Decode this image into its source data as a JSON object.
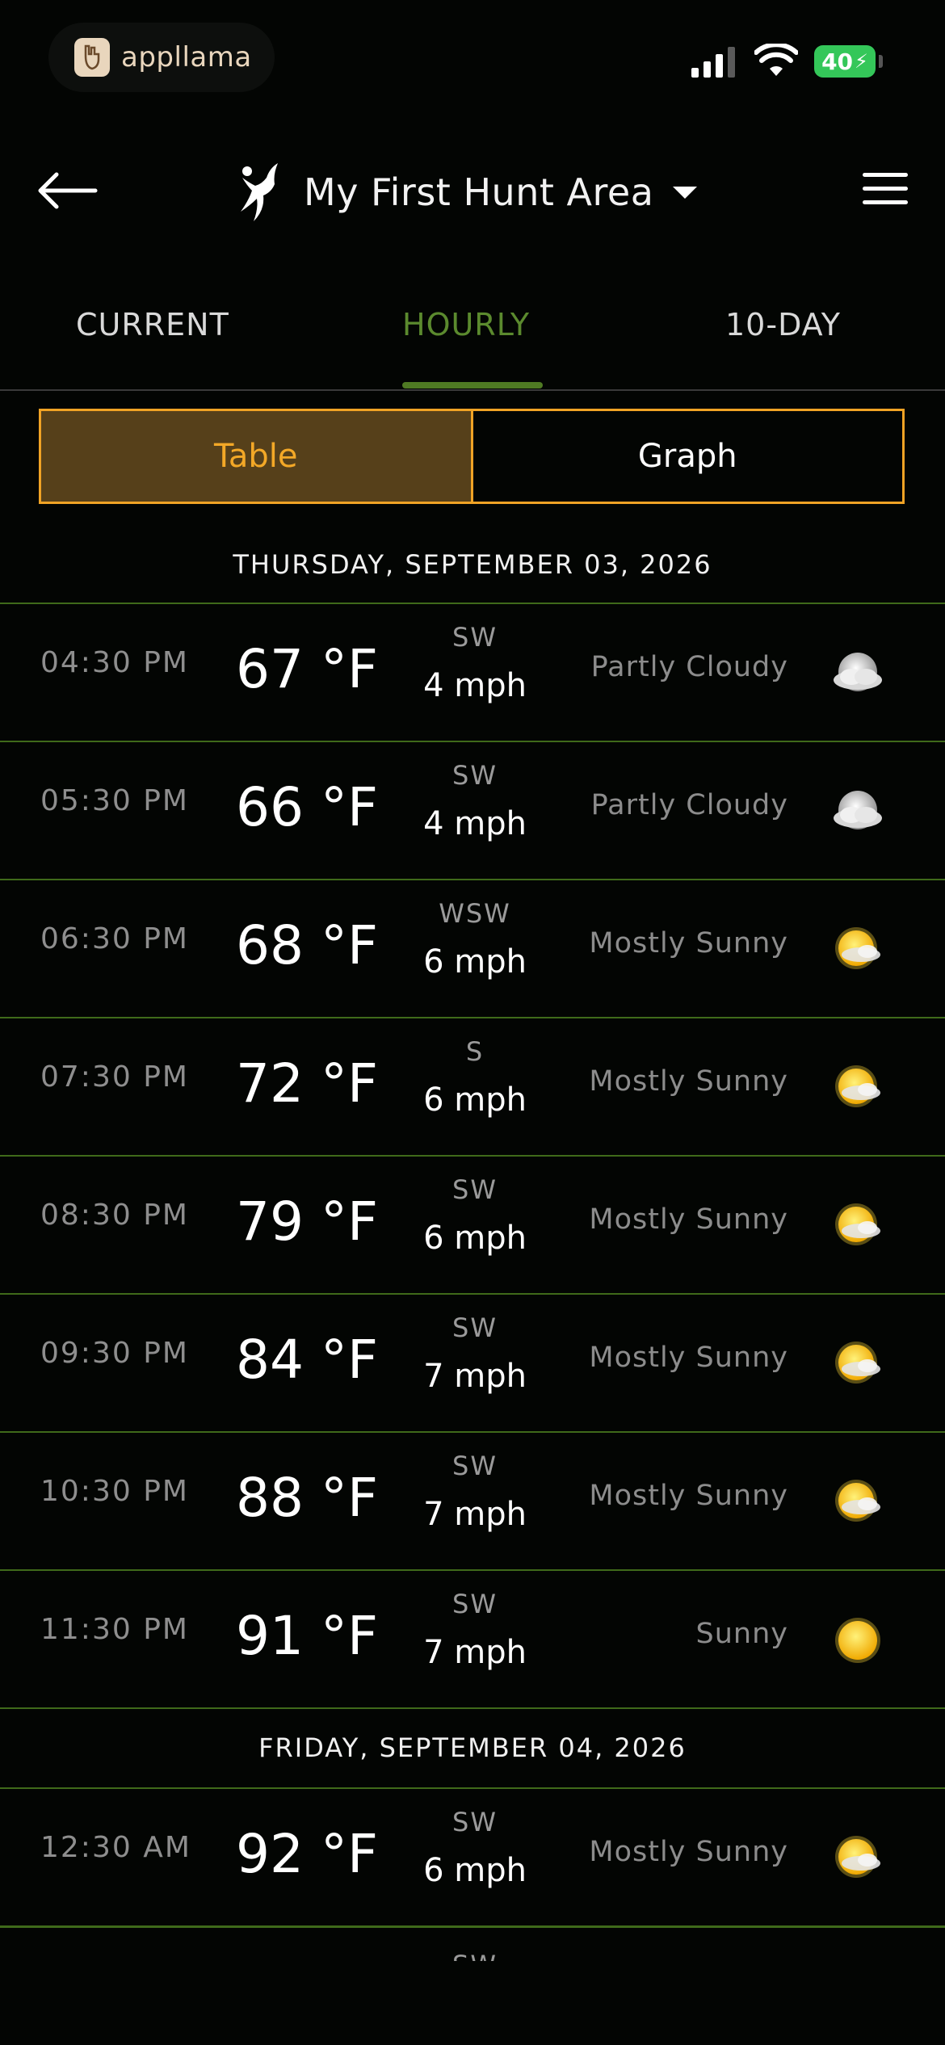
{
  "status_bar": {
    "app_name": "appllama",
    "battery": "40"
  },
  "header": {
    "title": "My First Hunt Area"
  },
  "tabs": [
    {
      "label": "CURRENT"
    },
    {
      "label": "HOURLY"
    },
    {
      "label": "10-DAY"
    }
  ],
  "active_tab": "HOURLY",
  "view_toggle": {
    "table_label": "Table",
    "graph_label": "Graph",
    "selected": "Table"
  },
  "colors": {
    "accent_green": "#4f7a23",
    "accent_orange": "#f0a325",
    "row_separator": "#3f6a1a"
  },
  "days": [
    {
      "date": "THURSDAY, SEPTEMBER 03, 2026",
      "rows": [
        {
          "time": "04:30 PM",
          "temp": "67 °F",
          "wind_dir": "SW",
          "wind_speed": "4 mph",
          "condition": "Partly Cloudy",
          "icon": "partly-cloudy-icon"
        },
        {
          "time": "05:30 PM",
          "temp": "66 °F",
          "wind_dir": "SW",
          "wind_speed": "4 mph",
          "condition": "Partly Cloudy",
          "icon": "partly-cloudy-icon"
        },
        {
          "time": "06:30 PM",
          "temp": "68 °F",
          "wind_dir": "WSW",
          "wind_speed": "6 mph",
          "condition": "Mostly Sunny",
          "icon": "mostly-sunny-icon"
        },
        {
          "time": "07:30 PM",
          "temp": "72 °F",
          "wind_dir": "S",
          "wind_speed": "6 mph",
          "condition": "Mostly Sunny",
          "icon": "mostly-sunny-icon"
        },
        {
          "time": "08:30 PM",
          "temp": "79 °F",
          "wind_dir": "SW",
          "wind_speed": "6 mph",
          "condition": "Mostly Sunny",
          "icon": "mostly-sunny-icon"
        },
        {
          "time": "09:30 PM",
          "temp": "84 °F",
          "wind_dir": "SW",
          "wind_speed": "7 mph",
          "condition": "Mostly Sunny",
          "icon": "mostly-sunny-icon"
        },
        {
          "time": "10:30 PM",
          "temp": "88 °F",
          "wind_dir": "SW",
          "wind_speed": "7 mph",
          "condition": "Mostly Sunny",
          "icon": "mostly-sunny-icon"
        },
        {
          "time": "11:30 PM",
          "temp": "91 °F",
          "wind_dir": "SW",
          "wind_speed": "7 mph",
          "condition": "Sunny",
          "icon": "sunny-icon"
        }
      ]
    },
    {
      "date": "FRIDAY, SEPTEMBER 04, 2026",
      "rows": [
        {
          "time": "12:30 AM",
          "temp": "92 °F",
          "wind_dir": "SW",
          "wind_speed": "6 mph",
          "condition": "Mostly Sunny",
          "icon": "mostly-sunny-icon"
        }
      ]
    }
  ],
  "partial_next_row": {
    "wind_dir": "SW"
  }
}
